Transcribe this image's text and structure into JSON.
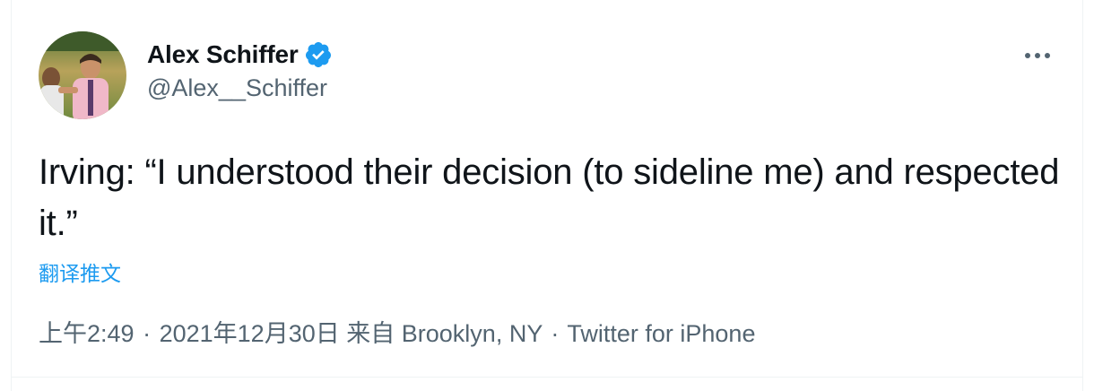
{
  "author": {
    "display_name": "Alex Schiffer",
    "handle": "@Alex__Schiffer",
    "verified": true,
    "verified_color": "#1d9bf0"
  },
  "tweet": {
    "text": "Irving: “I understood their decision (to sideline me) and respected it.”",
    "translate_label": "翻译推文"
  },
  "meta": {
    "time": "上午2:49",
    "date": "2021年12月30日",
    "location_prefix": "来自",
    "location": "Brooklyn, NY",
    "source": "Twitter for iPhone",
    "separator": "·"
  },
  "icons": {
    "more": "more-horizontal-icon",
    "verified": "verified-badge-icon"
  },
  "colors": {
    "text_primary": "#0f1419",
    "text_secondary": "#536471",
    "link": "#1d9bf0"
  }
}
